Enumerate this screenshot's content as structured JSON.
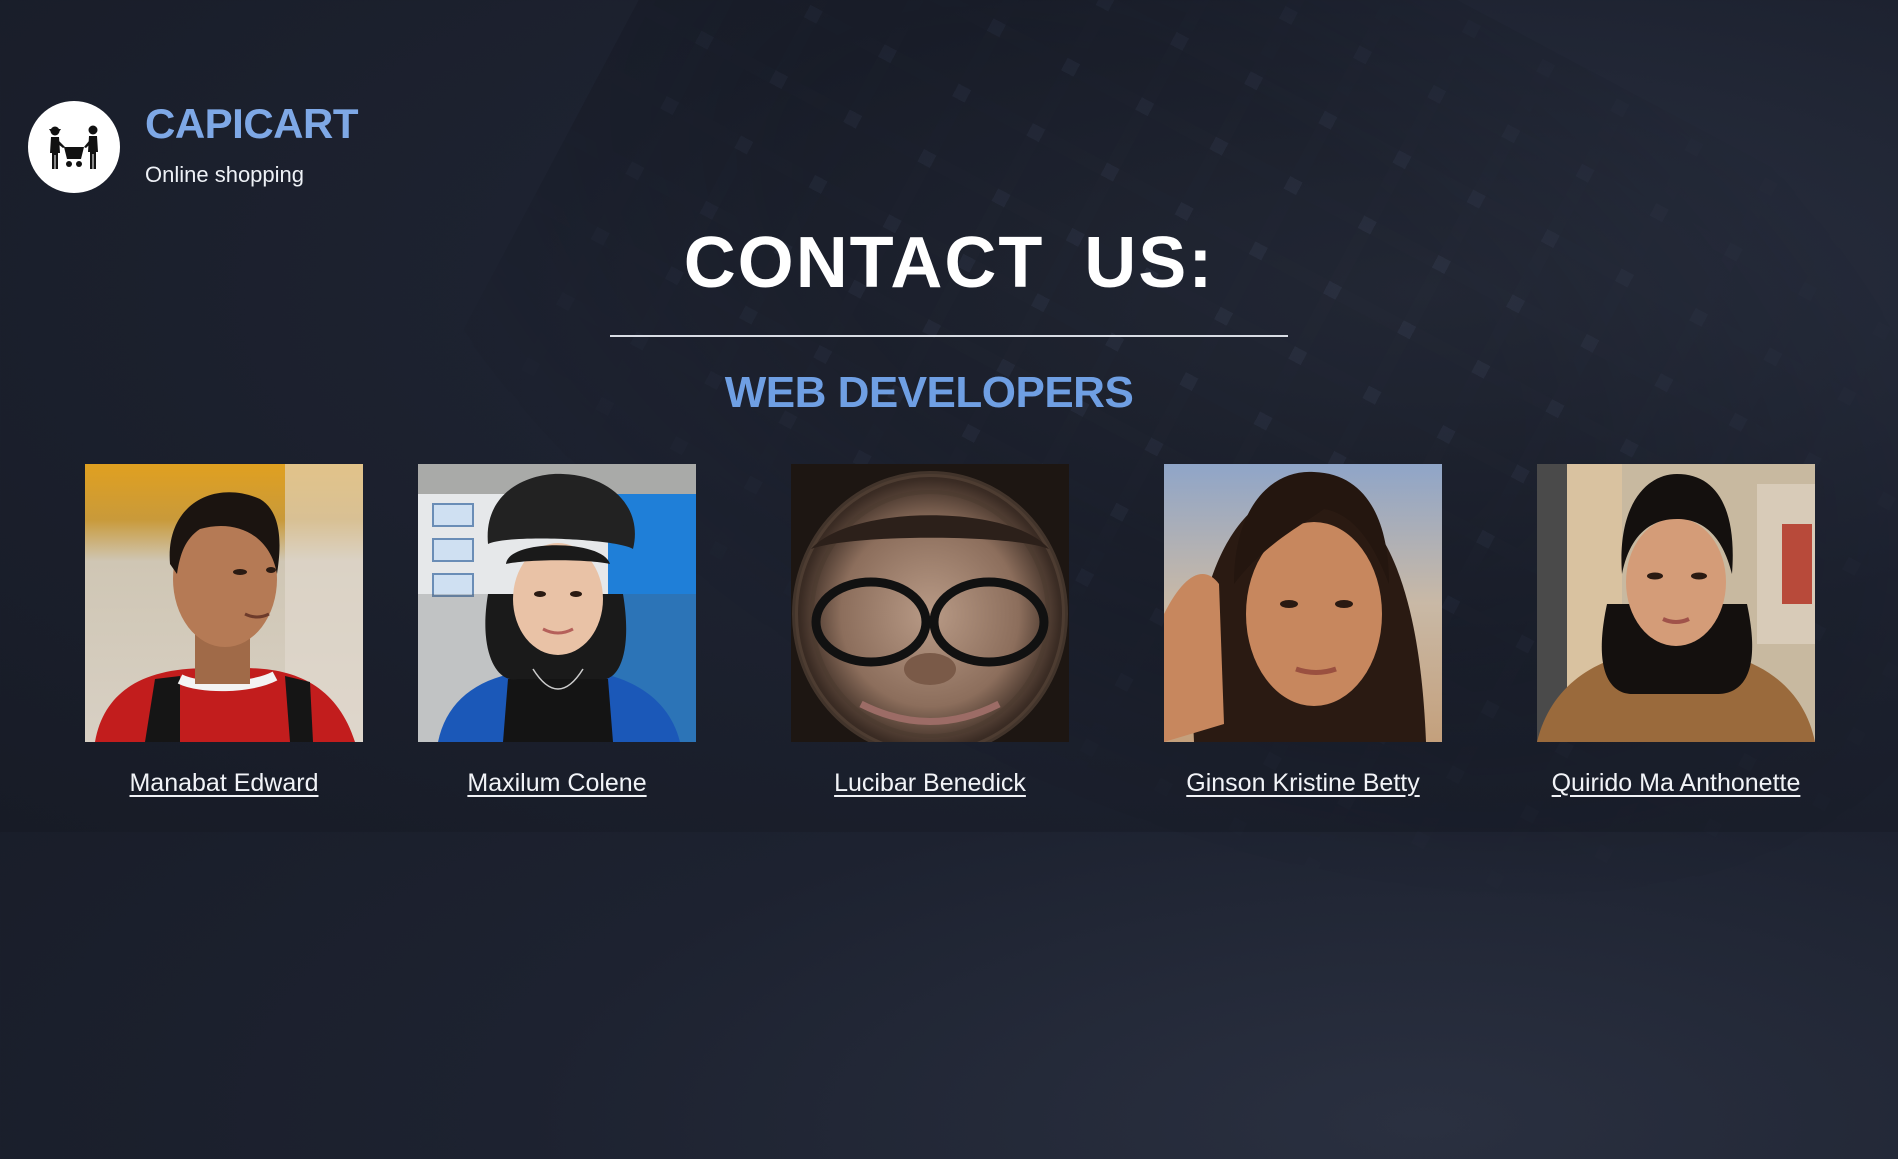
{
  "brand": {
    "name": "CAPICART",
    "tagline": "Online shopping",
    "logo_icon": "shopping-couple-icon"
  },
  "page": {
    "heading": "CONTACT US:",
    "subheading": "WEB DEVELOPERS"
  },
  "colors": {
    "accent": "#7ea8e6",
    "subheading": "#6f9fe3",
    "background": "#1d2230"
  },
  "developers": [
    {
      "name": "Manabat Edward",
      "photo": "portrait-young-man-red-shirt"
    },
    {
      "name": "Maxilum Colene",
      "photo": "portrait-girl-bucket-hat"
    },
    {
      "name": "Lucibar Benedick",
      "photo": "portrait-fisheye-glasses"
    },
    {
      "name": "Ginson Kristine Betty",
      "photo": "portrait-girl-long-hair"
    },
    {
      "name": "Quirido Ma Anthonette",
      "photo": "portrait-girl-brown-sweater"
    }
  ]
}
